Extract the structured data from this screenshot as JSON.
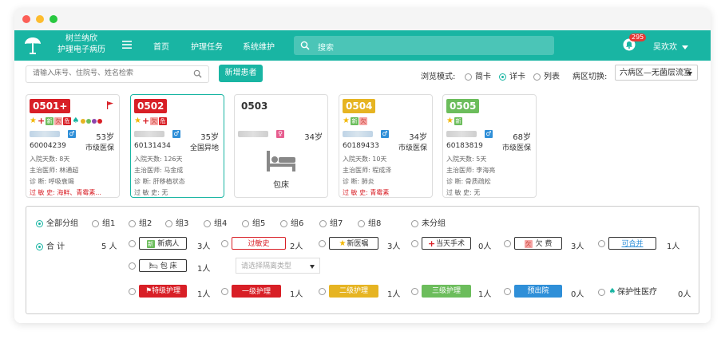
{
  "brand": {
    "line1": "树兰纳欣",
    "line2": "护理电子病历"
  },
  "nav": [
    "首页",
    "护理任务",
    "系统维护"
  ],
  "search": {
    "placeholder": "搜索"
  },
  "notifications": {
    "count": "295"
  },
  "user": {
    "name": "吴欢欢"
  },
  "toolbar": {
    "patient_search_placeholder": "请输入床号、住院号、姓名检索",
    "new_patient": "新增患者",
    "browse_mode_label": "浏览模式:",
    "modes": [
      "简卡",
      "详卡",
      "列表"
    ],
    "mode_selected": "详卡",
    "ward_label": "病区切换:",
    "ward_value": "六病区—无菌层流室"
  },
  "colors": {
    "accent": "#19b5a3",
    "red": "#d81f26",
    "yellow": "#e6b422",
    "green": "#6cbd5c",
    "blue": "#2f8fd8"
  },
  "cards": [
    {
      "bed": "0501+",
      "age": "53岁",
      "sex": "male",
      "id": "60004239",
      "insurance": "市级医保",
      "days": "入院天数:  8天",
      "doctor": "主治医师:  林通超",
      "diagnosis": "诊      断:  呼吸衰竭",
      "allergy": "过  敏  史:  海鲜、青霉素..."
    },
    {
      "bed": "0502",
      "age": "35岁",
      "sex": "male",
      "id": "60131434",
      "insurance": "全国异地",
      "days": "入院天数:  126天",
      "doctor": "主治医师:  马金成",
      "diagnosis": "诊      断:  肝移植状态",
      "allergy": "过  敏  史:  无"
    },
    {
      "bed": "0503",
      "age": "34岁",
      "sex": "female",
      "status": "包床"
    },
    {
      "bed": "0504",
      "age": "34岁",
      "sex": "male",
      "id": "60189433",
      "insurance": "市级医保",
      "days": "入院天数:  10天",
      "doctor": "主治医师:  程成泽",
      "diagnosis": "诊      断:  肺炎",
      "allergy": "过  敏  史:  青霉素"
    },
    {
      "bed": "0505",
      "age": "68岁",
      "sex": "male",
      "id": "60183819",
      "insurance": "市级医保",
      "days": "入院天数:  5天",
      "doctor": "主治医师:  李海亮",
      "diagnosis": "诊      断:  骨质疏松",
      "allergy": "过  敏  史:  无"
    }
  ],
  "groups": [
    "全部分组",
    "组1",
    "组2",
    "组3",
    "组4",
    "组5",
    "组6",
    "组7",
    "组8",
    "未分组"
  ],
  "group_selected": "全部分组",
  "total": {
    "label": "合      计",
    "count": "5 人"
  },
  "filters": [
    {
      "label": "新病人",
      "count": "3人"
    },
    {
      "label": "过敏史",
      "count": "2人"
    },
    {
      "label": "新医嘱",
      "count": "3人"
    },
    {
      "label": "当天手术",
      "count": "0人"
    },
    {
      "label": "欠  费",
      "count": "3人"
    },
    {
      "label": "可合并",
      "count": "1人"
    },
    {
      "label": "包  床",
      "count": "1人"
    },
    {
      "label": "特级护理",
      "count": "1人"
    },
    {
      "label": "一级护理",
      "count": "1人"
    },
    {
      "label": "二级护理",
      "count": "1人"
    },
    {
      "label": "三级护理",
      "count": "1人"
    },
    {
      "label": "预出院",
      "count": "0人"
    },
    {
      "label": "保护性医疗",
      "count": "0人"
    }
  ],
  "isolation_placeholder": "请选择隔离类型"
}
